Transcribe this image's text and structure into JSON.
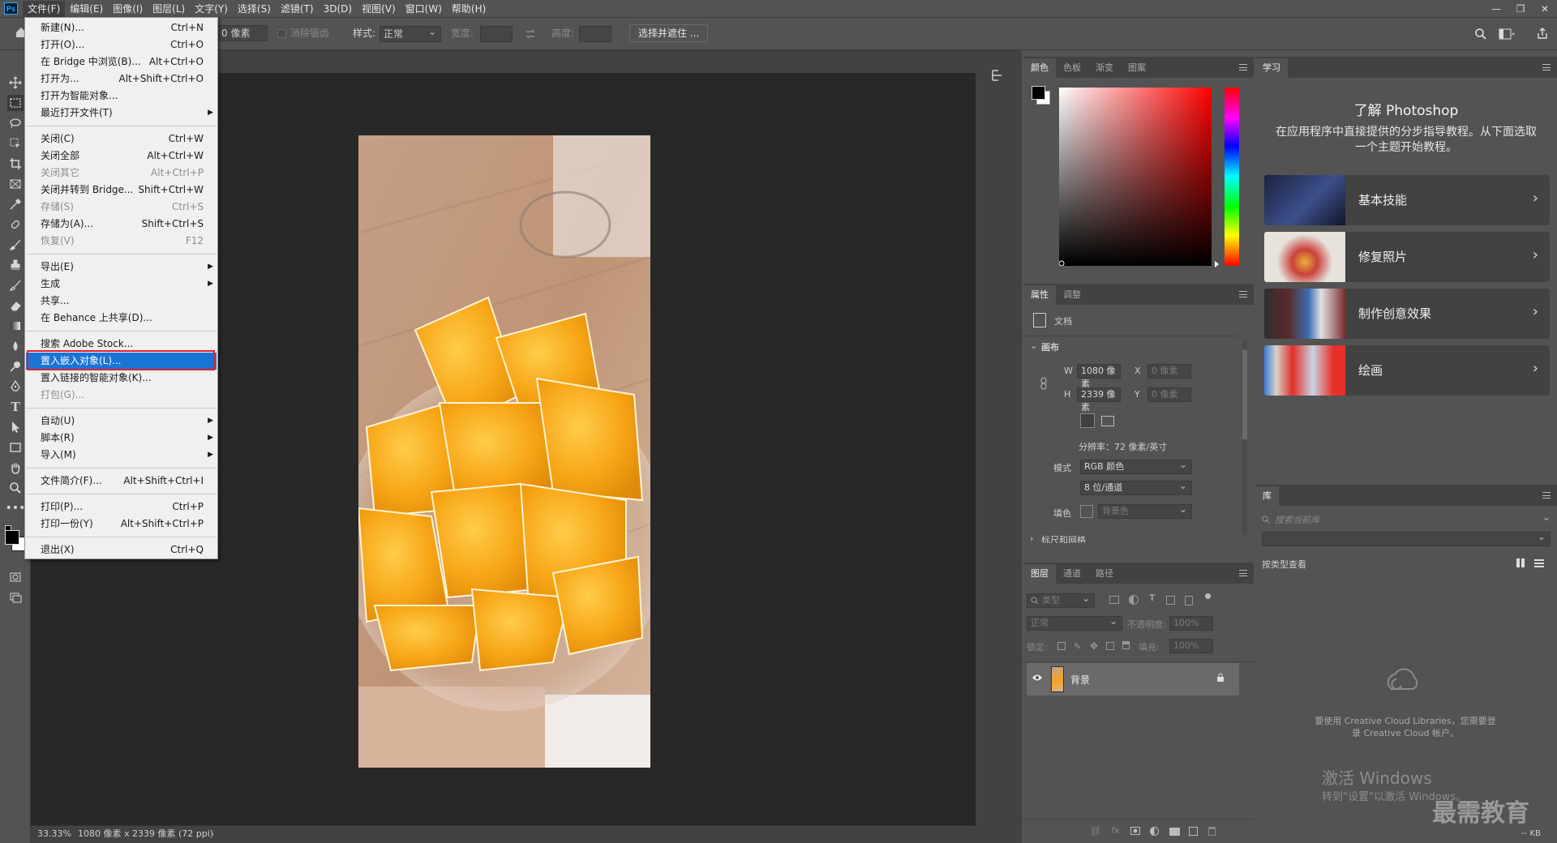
{
  "menubar": {
    "logo": "Ps",
    "items": [
      "文件(F)",
      "编辑(E)",
      "图像(I)",
      "图层(L)",
      "文字(Y)",
      "选择(S)",
      "滤镜(T)",
      "3D(D)",
      "视图(V)",
      "窗口(W)",
      "帮助(H)"
    ],
    "window_controls": [
      "—",
      "❐",
      "✕"
    ]
  },
  "options": {
    "feather_value": "0 像素",
    "antialias_label": "消除锯齿",
    "style_label": "样式:",
    "style_value": "正常",
    "width_label": "宽度:",
    "height_label": "高度:",
    "select_mask_button": "选择并遮住 ..."
  },
  "file_menu": {
    "items": [
      {
        "label": "新建(N)...",
        "shortcut": "Ctrl+N",
        "enabled": true
      },
      {
        "label": "打开(O)...",
        "shortcut": "Ctrl+O",
        "enabled": true
      },
      {
        "label": "在 Bridge 中浏览(B)...",
        "shortcut": "Alt+Ctrl+O",
        "enabled": true
      },
      {
        "label": "打开为...",
        "shortcut": "Alt+Shift+Ctrl+O",
        "enabled": true
      },
      {
        "label": "打开为智能对象...",
        "shortcut": "",
        "enabled": true
      },
      {
        "label": "最近打开文件(T)",
        "shortcut": "",
        "enabled": true,
        "submenu": true
      },
      {
        "label": "关闭(C)",
        "shortcut": "Ctrl+W",
        "enabled": true
      },
      {
        "label": "关闭全部",
        "shortcut": "Alt+Ctrl+W",
        "enabled": true
      },
      {
        "label": "关闭其它",
        "shortcut": "Alt+Ctrl+P",
        "enabled": false
      },
      {
        "label": "关闭并转到 Bridge...",
        "shortcut": "Shift+Ctrl+W",
        "enabled": true
      },
      {
        "label": "存储(S)",
        "shortcut": "Ctrl+S",
        "enabled": false
      },
      {
        "label": "存储为(A)...",
        "shortcut": "Shift+Ctrl+S",
        "enabled": true
      },
      {
        "label": "恢复(V)",
        "shortcut": "F12",
        "enabled": false
      },
      {
        "label": "导出(E)",
        "shortcut": "",
        "enabled": true,
        "submenu": true
      },
      {
        "label": "生成",
        "shortcut": "",
        "enabled": true,
        "submenu": true
      },
      {
        "label": "共享...",
        "shortcut": "",
        "enabled": true
      },
      {
        "label": "在 Behance 上共享(D)...",
        "shortcut": "",
        "enabled": true
      },
      {
        "label": "搜索 Adobe Stock...",
        "shortcut": "",
        "enabled": true
      },
      {
        "label": "置入嵌入对象(L)...",
        "shortcut": "",
        "enabled": true,
        "highlighted": true
      },
      {
        "label": "置入链接的智能对象(K)...",
        "shortcut": "",
        "enabled": true
      },
      {
        "label": "打包(G)...",
        "shortcut": "",
        "enabled": false
      },
      {
        "label": "自动(U)",
        "shortcut": "",
        "enabled": true,
        "submenu": true
      },
      {
        "label": "脚本(R)",
        "shortcut": "",
        "enabled": true,
        "submenu": true
      },
      {
        "label": "导入(M)",
        "shortcut": "",
        "enabled": true,
        "submenu": true
      },
      {
        "label": "文件简介(F)...",
        "shortcut": "Alt+Shift+Ctrl+I",
        "enabled": true
      },
      {
        "label": "打印(P)...",
        "shortcut": "Ctrl+P",
        "enabled": true
      },
      {
        "label": "打印一份(Y)",
        "shortcut": "Alt+Shift+Ctrl+P",
        "enabled": true
      },
      {
        "label": "退出(X)",
        "shortcut": "Ctrl+Q",
        "enabled": true
      }
    ]
  },
  "status": {
    "zoom": "33.33%",
    "doc_info": "1080 像素 x 2339 像素 (72 ppi)"
  },
  "color_panel": {
    "tabs": [
      "颜色",
      "色板",
      "渐变",
      "图案"
    ],
    "foreground": "#000000",
    "background": "#ffffff"
  },
  "properties_panel": {
    "tabs": [
      "属性",
      "调整"
    ],
    "doc_label": "文档",
    "canvas_section": "画布",
    "w_label": "W",
    "w_value": "1080 像素",
    "h_label": "H",
    "h_value": "2339 像素",
    "x_label": "X",
    "x_value": "0 像素",
    "y_label": "Y",
    "y_value": "0 像素",
    "resolution": "分辨率：72 像素/英寸",
    "mode_label": "模式",
    "mode_value": "RGB 颜色",
    "depth_value": "8 位/通道",
    "fill_label": "填色",
    "fill_value": "背景色",
    "next_section": "标尺和网格"
  },
  "layers_panel": {
    "tabs": [
      "图层",
      "通道",
      "路径"
    ],
    "filter_placeholder": "类型",
    "blend_mode": "正常",
    "opacity_label": "不透明度:",
    "opacity_value": "100%",
    "lock_label": "锁定:",
    "fill_label": "填充:",
    "fill_value": "100%",
    "layers": [
      {
        "name": "背景",
        "visible": true,
        "locked": true
      }
    ]
  },
  "learn_panel": {
    "tab": "学习",
    "title": "了解 Photoshop",
    "description": "在应用程序中直接提供的分步指导教程。从下面选取一个主题开始教程。",
    "cards": [
      {
        "title": "基本技能"
      },
      {
        "title": "修复照片"
      },
      {
        "title": "制作创意效果"
      },
      {
        "title": "绘画"
      }
    ]
  },
  "library_panel": {
    "tab": "库",
    "search_placeholder": "搜索当前库",
    "view_by": "按类型查看",
    "cc_message": "要使用 Creative Cloud Libraries，您需要登录 Creative Cloud 帐户。",
    "footer_size": "-- KB"
  },
  "watermarks": {
    "activate_title": "激活 Windows",
    "activate_sub": "转到\"设置\"以激活 Windows。",
    "brand": "最需教育"
  }
}
